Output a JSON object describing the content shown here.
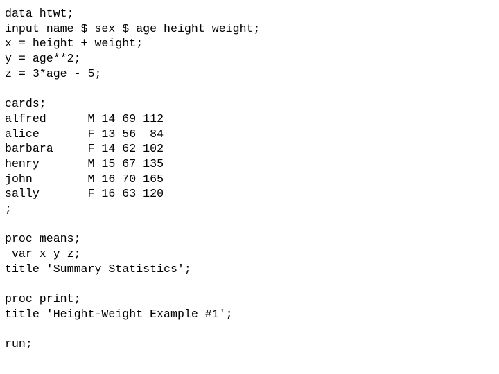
{
  "document": {
    "kind": "sas-program-source-listing",
    "background_color": "#ffffff",
    "text_color": "#000000",
    "lines": [
      "data htwt;",
      "input name $ sex $ age height weight;",
      "x = height + weight;",
      "y = age**2;",
      "z = 3*age - 5;",
      "",
      "cards;",
      "alfred      M 14 69 112",
      "alice       F 13 56  84",
      "barbara     F 14 62 102",
      "henry       M 15 67 135",
      "john        M 16 70 165",
      "sally       F 16 63 120",
      ";",
      "",
      "proc means;",
      " var x y z;",
      "title 'Summary Statistics';",
      "",
      "proc print;",
      "title 'Height-Weight Example #1';",
      "",
      "run;"
    ],
    "statements": {
      "data_step_name": "htwt",
      "input_statement": "input name $ sex $ age height weight;",
      "computed_variables": [
        "x = height + weight;",
        "y = age**2;",
        "z = 3*age - 5;"
      ],
      "cards_keyword": "cards;",
      "end_of_data_marker": ";",
      "proc_means": "proc means;",
      "var_statement": " var x y z;",
      "title_means": "title 'Summary Statistics';",
      "proc_print": "proc print;",
      "title_print": "title 'Height-Weight Example #1';",
      "run_statement": "run;"
    },
    "inline_data": {
      "columns": [
        "name",
        "sex",
        "age",
        "height",
        "weight"
      ],
      "rows": [
        {
          "name": "alfred",
          "sex": "M",
          "age": "14",
          "height": "69",
          "weight": "112"
        },
        {
          "name": "alice",
          "sex": "F",
          "age": "13",
          "height": "56",
          "weight": "84"
        },
        {
          "name": "barbara",
          "sex": "F",
          "age": "14",
          "height": "62",
          "weight": "102"
        },
        {
          "name": "henry",
          "sex": "M",
          "age": "15",
          "height": "67",
          "weight": "135"
        },
        {
          "name": "john",
          "sex": "M",
          "age": "16",
          "height": "70",
          "weight": "165"
        },
        {
          "name": "sally",
          "sex": "F",
          "age": "16",
          "height": "63",
          "weight": "120"
        }
      ]
    },
    "titles": [
      "Summary Statistics",
      "Height-Weight Example #1"
    ]
  }
}
